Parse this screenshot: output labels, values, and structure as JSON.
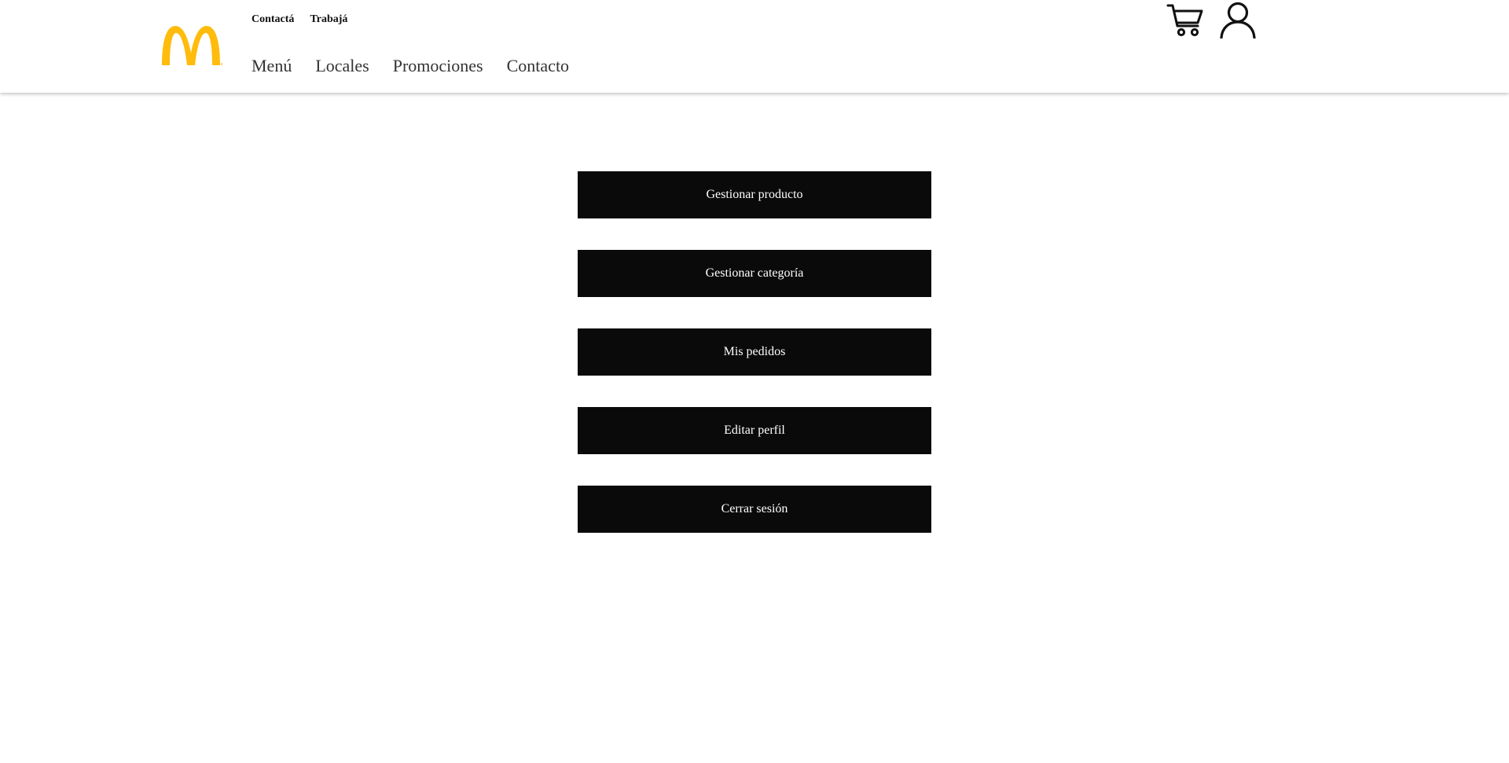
{
  "brand": {
    "logo_icon": "mcdonalds-arches-logo",
    "logo_color": "#FFBC0D"
  },
  "header": {
    "top_links": [
      {
        "label": "Contactá"
      },
      {
        "label": "Trabajá"
      }
    ],
    "nav": [
      {
        "label": "Menú"
      },
      {
        "label": "Locales"
      },
      {
        "label": "Promociones"
      },
      {
        "label": "Contacto"
      }
    ],
    "icons": {
      "cart": "shopping-cart-icon",
      "user": "user-account-icon"
    }
  },
  "account_menu": {
    "buttons": [
      {
        "label": "Gestionar producto"
      },
      {
        "label": "Gestionar categoría"
      },
      {
        "label": "Mis pedidos"
      },
      {
        "label": "Editar perfil"
      },
      {
        "label": "Cerrar sesión"
      }
    ]
  },
  "colors": {
    "button_bg": "#0a0a0a",
    "button_text": "#ffffff",
    "nav_text": "#333333"
  }
}
